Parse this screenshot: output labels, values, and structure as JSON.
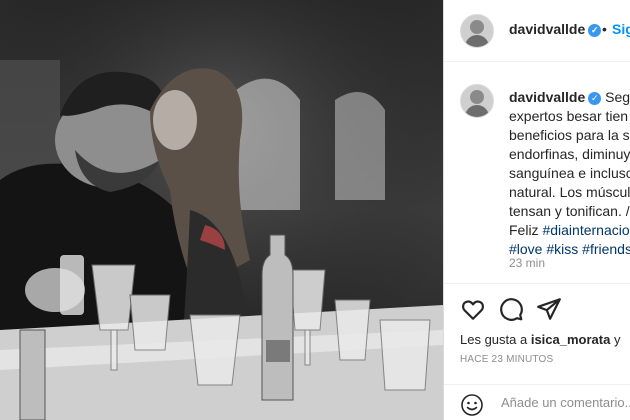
{
  "post": {
    "author": "davidvallde",
    "follow_label": "Sig",
    "dot": "•",
    "caption_author": "davidvallde",
    "caption_lines": [
      "Segú",
      "expertos besar tien",
      "beneficios para la s",
      "endorfinas, diminuy",
      "sanguínea e inclusc",
      "natural. Los múscul",
      "tensan y tonifican. /"
    ],
    "caption_line8_text": "Feliz ",
    "caption_line8_tag": "#diainternacio",
    "caption_line9_tags": [
      "#love",
      "#kiss",
      "#friends"
    ],
    "time": "23 min"
  },
  "actions": {
    "likes_prefix": "Les gusta a ",
    "likes_user": "isica_morata",
    "likes_suffix": " y",
    "timestamp": "HACE 23 MINUTOS"
  },
  "comment": {
    "placeholder": "Añade un comentario..."
  },
  "icons": {
    "verified": "verified-badge-icon",
    "like": "heart-icon",
    "comment": "comment-bubble-icon",
    "share": "paper-plane-icon",
    "emoji": "smiley-emoji-icon"
  },
  "colors": {
    "link": "#0095f6",
    "hashtag": "#00376b",
    "verified": "#3897f0",
    "muted": "#8e8e8e"
  }
}
